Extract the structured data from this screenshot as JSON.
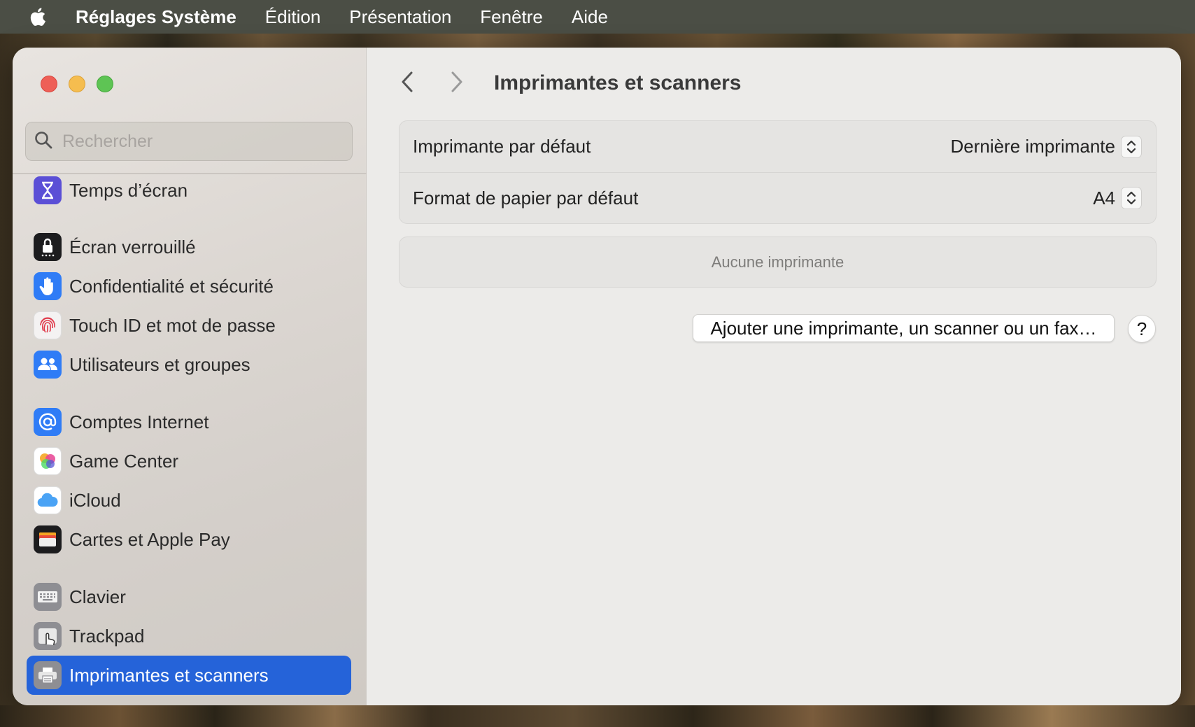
{
  "menubar": {
    "apple_icon": "apple-logo",
    "app_name": "Réglages Système",
    "items": [
      "Édition",
      "Présentation",
      "Fenêtre",
      "Aide"
    ]
  },
  "sidebar": {
    "search_placeholder": "Rechercher",
    "items": [
      {
        "label": "Temps d’écran",
        "icon": "hourglass-icon",
        "color": "#5b4fd6"
      },
      {
        "label": "Écran verrouillé",
        "icon": "lock-screen-icon",
        "color": "#1c1c1e"
      },
      {
        "label": "Confidentialité et sécurité",
        "icon": "hand-icon",
        "color": "#2f7cf6"
      },
      {
        "label": "Touch ID et mot de passe",
        "icon": "fingerprint-icon",
        "color": "#f2f2f2"
      },
      {
        "label": "Utilisateurs et groupes",
        "icon": "users-icon",
        "color": "#2f7cf6"
      },
      {
        "label": "Comptes Internet",
        "icon": "at-icon",
        "color": "#2f7cf6"
      },
      {
        "label": "Game Center",
        "icon": "game-center-icon",
        "color": "#ffffff"
      },
      {
        "label": "iCloud",
        "icon": "cloud-icon",
        "color": "#ffffff"
      },
      {
        "label": "Cartes et Apple Pay",
        "icon": "wallet-icon",
        "color": "#1c1c1e"
      },
      {
        "label": "Clavier",
        "icon": "keyboard-icon",
        "color": "#8e8e93"
      },
      {
        "label": "Trackpad",
        "icon": "trackpad-icon",
        "color": "#8e8e93"
      },
      {
        "label": "Imprimantes et scanners",
        "icon": "printer-icon",
        "color": "#8e8e93",
        "selected": true
      }
    ]
  },
  "main": {
    "title": "Imprimantes et scanners",
    "settings": [
      {
        "label": "Imprimante par défaut",
        "value": "Dernière imprimante"
      },
      {
        "label": "Format de papier par défaut",
        "value": "A4"
      }
    ],
    "empty_state": "Aucune imprimante",
    "add_button": "Ajouter une imprimante, un scanner ou un fax…",
    "help_button": "?"
  },
  "colors": {
    "accent": "#2563d9",
    "close": "#ee5f57",
    "minimize": "#f5bd4f",
    "maximize": "#5ec454"
  }
}
